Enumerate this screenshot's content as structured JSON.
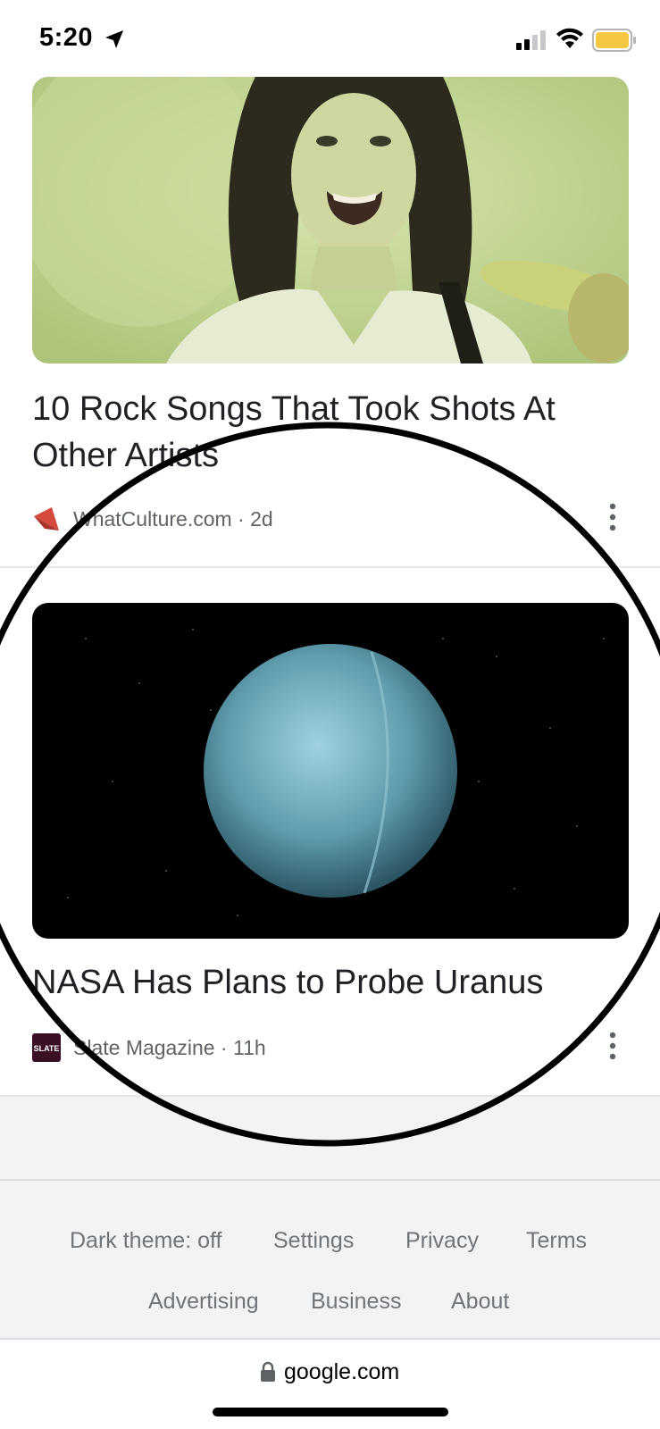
{
  "status_bar": {
    "time": "5:20",
    "icons": [
      "location-arrow-icon",
      "cellular-signal-icon",
      "wifi-icon",
      "battery-icon"
    ],
    "battery_color": "#f5c842"
  },
  "articles": [
    {
      "title": "10 Rock Songs That Took Shots At Other Artists",
      "source": "WhatCulture.com · 2d",
      "source_icon": "whatculture-logo-icon",
      "image": "musician-video-still"
    },
    {
      "title": "NASA Has Plans to Probe Uranus",
      "source": "Slate Magazine · 11h",
      "source_icon": "slate-logo-icon",
      "source_logo_text": "SLATE",
      "image": "uranus-planet-image"
    }
  ],
  "footer": {
    "links_row1": [
      "Dark theme: off",
      "Settings",
      "Privacy",
      "Terms"
    ],
    "links_row2": [
      "Advertising",
      "Business",
      "About"
    ]
  },
  "url_bar": {
    "url": "google.com"
  },
  "colors": {
    "slate_brand": "#3a0f26",
    "whatculture_brand": "#d44b3d",
    "footer_bg": "#f1f3f4"
  }
}
